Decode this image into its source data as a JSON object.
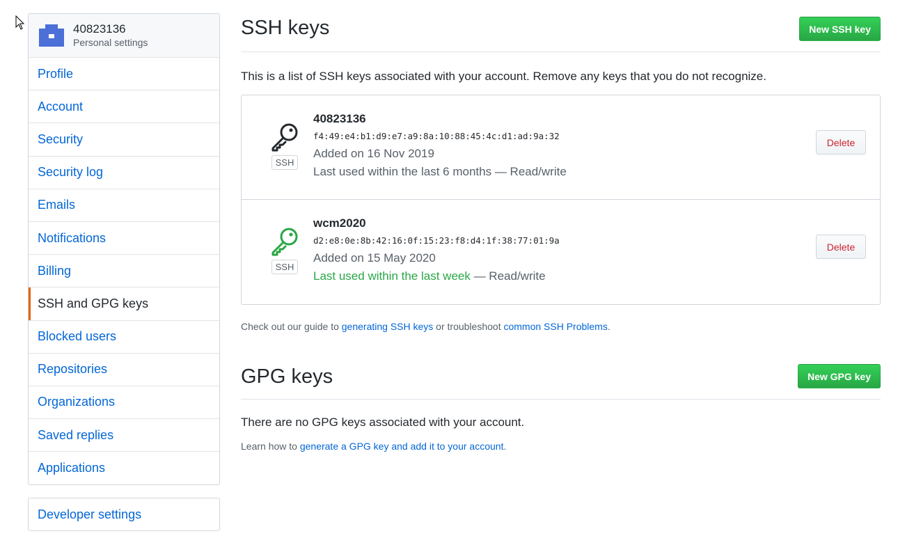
{
  "sidebar": {
    "username": "40823136",
    "subtitle": "Personal settings",
    "items": [
      {
        "label": "Profile",
        "selected": false
      },
      {
        "label": "Account",
        "selected": false
      },
      {
        "label": "Security",
        "selected": false
      },
      {
        "label": "Security log",
        "selected": false
      },
      {
        "label": "Emails",
        "selected": false
      },
      {
        "label": "Notifications",
        "selected": false
      },
      {
        "label": "Billing",
        "selected": false
      },
      {
        "label": "SSH and GPG keys",
        "selected": true
      },
      {
        "label": "Blocked users",
        "selected": false
      },
      {
        "label": "Repositories",
        "selected": false
      },
      {
        "label": "Organizations",
        "selected": false
      },
      {
        "label": "Saved replies",
        "selected": false
      },
      {
        "label": "Applications",
        "selected": false
      }
    ],
    "developer_settings": "Developer settings"
  },
  "ssh": {
    "title": "SSH keys",
    "new_button": "New SSH key",
    "description": "This is a list of SSH keys associated with your account. Remove any keys that you do not recognize.",
    "keys": [
      {
        "title": "40823136",
        "fingerprint": "f4:49:e4:b1:d9:e7:a9:8a:10:88:45:4c:d1:ad:9a:32",
        "added": "Added on 16 Nov 2019",
        "last_used": "Last used within the last 6 months",
        "access": " — Read/write",
        "badge": "SSH",
        "delete_label": "Delete",
        "icon": "key-icon",
        "icon_color": "#24292e"
      },
      {
        "title": "wcm2020",
        "fingerprint": "d2:e8:0e:8b:42:16:0f:15:23:f8:d4:1f:38:77:01:9a",
        "added": "Added on 15 May 2020",
        "last_used": "Last used within the last week",
        "access": " — Read/write",
        "badge": "SSH",
        "delete_label": "Delete",
        "icon": "key-icon",
        "icon_color": "#28a745"
      }
    ],
    "guide": {
      "prefix": "Check out our guide to ",
      "link1": "generating SSH keys",
      "middle": " or troubleshoot ",
      "link2": "common SSH Problems",
      "suffix": "."
    }
  },
  "gpg": {
    "title": "GPG keys",
    "new_button": "New GPG key",
    "empty": "There are no GPG keys associated with your account.",
    "learn_prefix": "Learn how to ",
    "learn_link": "generate a GPG key and add it to your account",
    "learn_suffix": "."
  },
  "colors": {
    "accent_selected": "#e36209",
    "link": "#0366d6",
    "green": "#28a745",
    "danger": "#cb2431",
    "avatar": "#4c6fd8"
  }
}
